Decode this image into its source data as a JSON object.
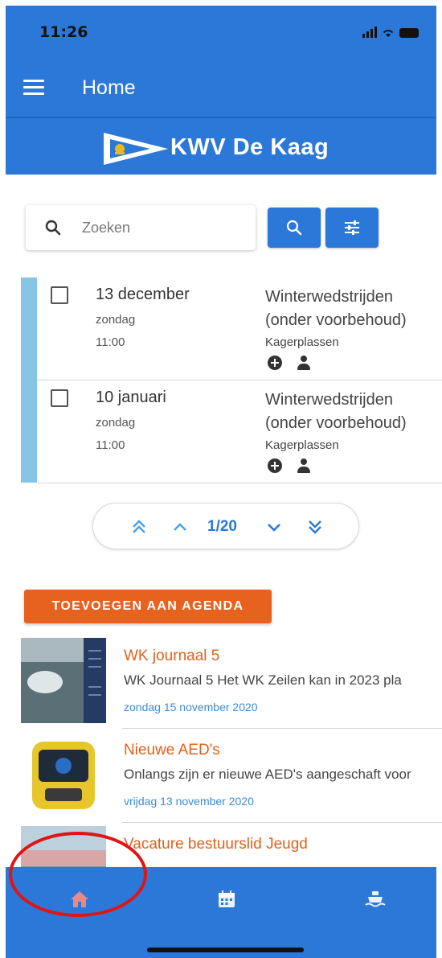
{
  "status_bar": {
    "time": "11:26"
  },
  "app_bar": {
    "title": "Home"
  },
  "brand": {
    "name": "KWV De Kaag"
  },
  "search": {
    "placeholder": "Zoeken"
  },
  "events": [
    {
      "date": "13 december",
      "day": "zondag",
      "time": "11:00",
      "title": "Winterwedstrijden (onder voorbehoud)",
      "location": "Kagerplassen"
    },
    {
      "date": "10 januari",
      "day": "zondag",
      "time": "11:00",
      "title": "Winterwedstrijden (onder voorbehoud)",
      "location": "Kagerplassen"
    }
  ],
  "pager": {
    "label": "1/20"
  },
  "add_agenda_label": "TOEVOEGEN AAN AGENDA",
  "news": [
    {
      "title": "WK journaal 5",
      "excerpt": "WK Journaal 5 Het WK Zeilen kan in 2023 pla",
      "date": "zondag 15 november 2020"
    },
    {
      "title": "Nieuwe AED's",
      "excerpt": "Onlangs zijn er nieuwe AED's aangeschaft voor",
      "date": "vrijdag 13 november 2020"
    },
    {
      "title": "Vacature bestuurslid Jeugd",
      "excerpt": "",
      "date": ""
    }
  ],
  "bottom_nav": {
    "items": [
      "home-icon",
      "calendar-icon",
      "boat-icon"
    ]
  },
  "colors": {
    "primary": "#2b78d8",
    "accent": "#e8621f",
    "event_accent": "#86c6e4",
    "highlight": "#e01414"
  }
}
